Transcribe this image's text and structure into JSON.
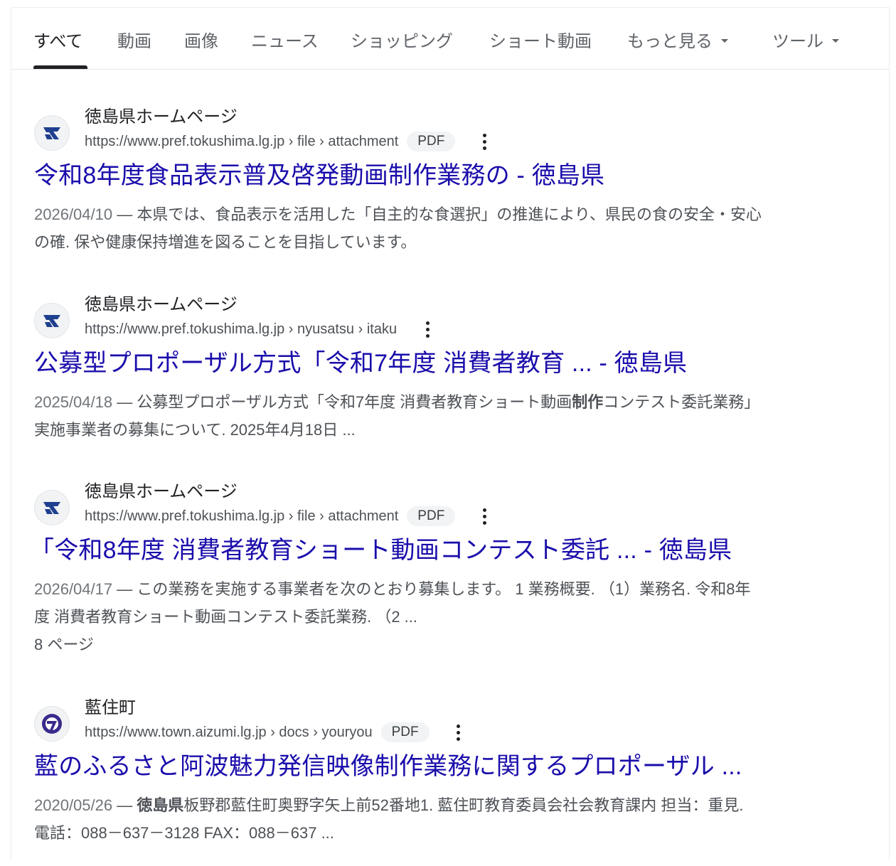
{
  "tabs": [
    {
      "label": "すべて",
      "active": true
    },
    {
      "label": "動画"
    },
    {
      "label": "画像"
    },
    {
      "label": "ニュース"
    },
    {
      "label": "ショッピング"
    },
    {
      "label": "ショート動画"
    },
    {
      "label": "もっと見る"
    },
    {
      "label": "ツール"
    }
  ],
  "colors": {
    "link": "#1a0dab",
    "accent": "#202124",
    "muted": "#4d5156"
  },
  "results": [
    {
      "site_name": "徳島県ホームページ",
      "url": "https://www.pref.tokushima.lg.jp › file › attachment",
      "badge": "PDF",
      "favicon": "tokushima-logo-icon",
      "title": "令和8年度食品表示普及啓発動画制作業務の - 徳島県",
      "date": "2026/04/10",
      "separator": " — ",
      "snippet_1": "本県では、食品表示を活用した「自主的な食選択」の推進により、県民の食の安全・安心",
      "snippet_2": "の確. 保や健康保持増進を図ることを目指しています。"
    },
    {
      "site_name": "徳島県ホームページ",
      "url": "https://www.pref.tokushima.lg.jp › nyusatsu › itaku",
      "favicon": "tokushima-logo-icon",
      "title": "公募型プロポーザル方式「令和7年度 消費者教育 ... - 徳島県",
      "date": "2025/04/18",
      "separator": " — ",
      "snippet_1a": "公募型プロポーザル方式「令和7年度 消費者教育ショート動画",
      "snippet_1b": "制作",
      "snippet_1c": "コンテスト委託業務」",
      "snippet_2": "実施事業者の募集について. 2025年4月18日 ..."
    },
    {
      "site_name": "徳島県ホームページ",
      "url": "https://www.pref.tokushima.lg.jp › file › attachment",
      "badge": "PDF",
      "favicon": "tokushima-logo-icon",
      "title": "「令和8年度 消費者教育ショート動画コンテスト委託 ... - 徳島県",
      "date": "2026/04/17",
      "separator": " — ",
      "snippet_1": "この業務を実施する事業者を次のとおり募集します。 1 業務概要. （1）業務名. 令和8年",
      "snippet_2": "度 消費者教育ショート動画コンテスト委託業務. （2 ...",
      "pages": "8 ページ"
    },
    {
      "site_name": "藍住町",
      "url": "https://www.town.aizumi.lg.jp › docs › youryou",
      "badge": "PDF",
      "favicon": "aizumi-logo-icon",
      "title": "藍のふるさと阿波魅力発信映像制作業務に関するプロポーザル ...",
      "date": "2020/05/26",
      "separator": " — ",
      "snippet_1a": "徳島県",
      "snippet_1b": "板野郡藍住町奥野字矢上前52番地1. 藍住町教育委員会社会教育課内 担当：重見.",
      "snippet_2": "電話：088－637－3128 FAX：088－637 ..."
    }
  ]
}
